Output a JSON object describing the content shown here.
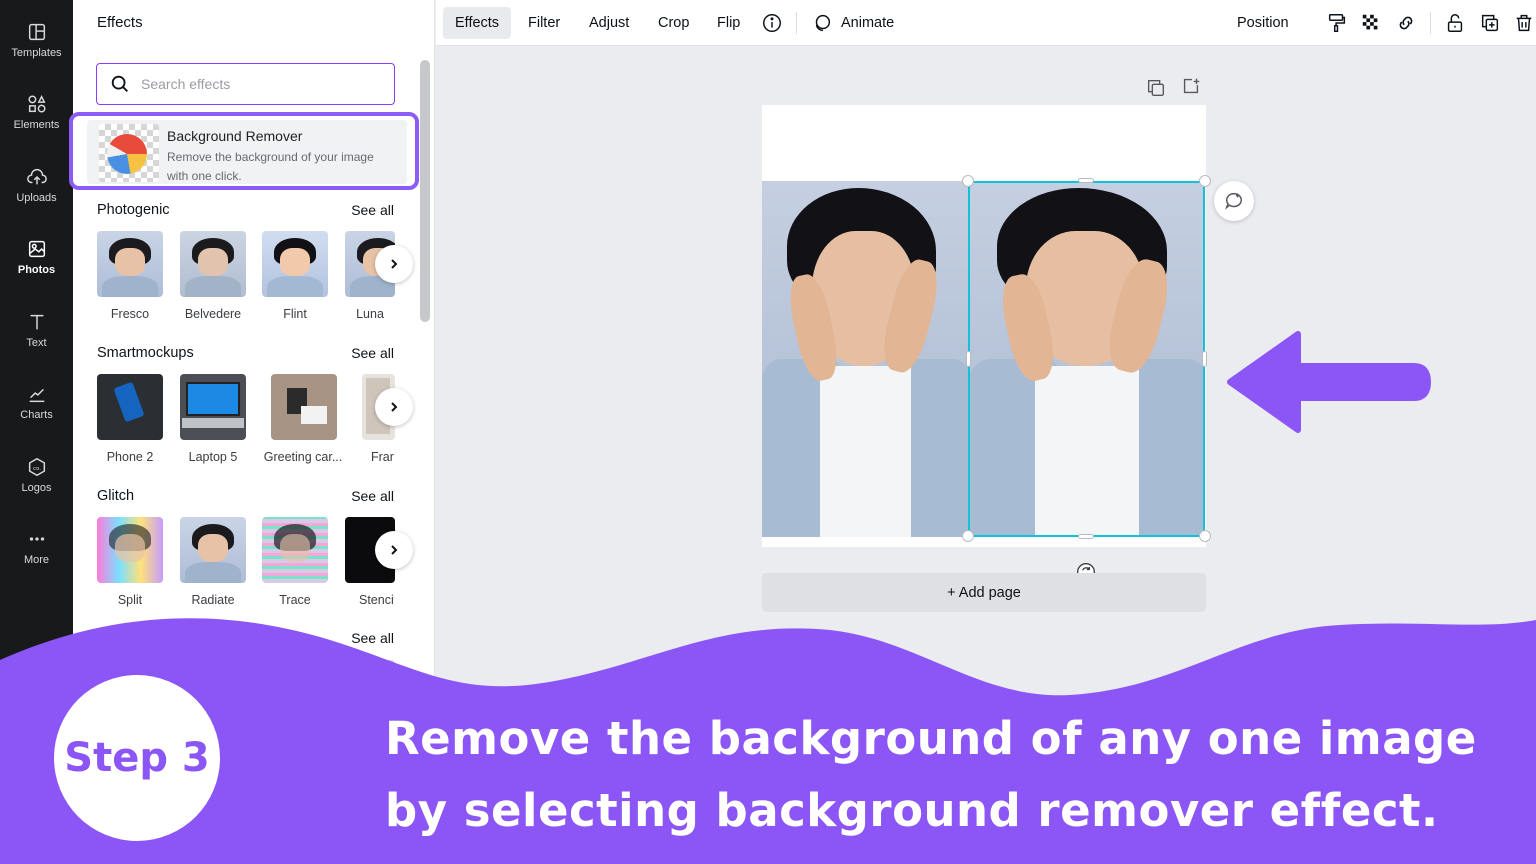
{
  "sidebar": {
    "items": [
      {
        "label": "Templates",
        "icon": "templates-icon"
      },
      {
        "label": "Elements",
        "icon": "elements-icon"
      },
      {
        "label": "Uploads",
        "icon": "uploads-icon"
      },
      {
        "label": "Photos",
        "icon": "photos-icon"
      },
      {
        "label": "Text",
        "icon": "text-icon"
      },
      {
        "label": "Charts",
        "icon": "charts-icon"
      },
      {
        "label": "Logos",
        "icon": "logos-icon"
      },
      {
        "label": "More",
        "icon": "more-icon"
      }
    ],
    "active": "Photos"
  },
  "panel": {
    "title": "Effects",
    "search_placeholder": "Search effects",
    "bg_remover": {
      "name": "Background Remover",
      "description": "Remove the background of your image with one click."
    },
    "sections": [
      {
        "title": "Photogenic",
        "see_all": "See all",
        "items": [
          "Fresco",
          "Belvedere",
          "Flint",
          "Luna"
        ]
      },
      {
        "title": "Smartmockups",
        "see_all": "See all",
        "items": [
          "Phone 2",
          "Laptop 5",
          "Greeting car...",
          "Frar"
        ]
      },
      {
        "title": "Glitch",
        "see_all": "See all",
        "items": [
          "Split",
          "Radiate",
          "Trace",
          "Stenci"
        ]
      },
      {
        "title": "",
        "see_all": "See all",
        "items": []
      }
    ]
  },
  "toolbar": {
    "buttons": [
      "Effects",
      "Filter",
      "Adjust",
      "Crop",
      "Flip"
    ],
    "active": "Effects",
    "animate": "Animate",
    "position": "Position"
  },
  "canvas": {
    "add_page": "+ Add page"
  },
  "overlay": {
    "step": "Step 3",
    "caption_line1": "Remove the background of any one image",
    "caption_line2": "by selecting background remover effect.",
    "color": "#8b56f5"
  }
}
